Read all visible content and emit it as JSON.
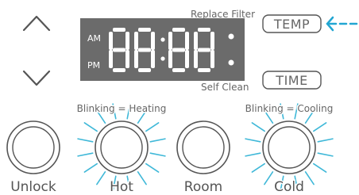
{
  "panel": {
    "replace_filter_label": "Replace Filter",
    "self_clean_label": "Self Clean",
    "temp_button_label": "TEMP",
    "time_button_label": "TIME",
    "am_label": "AM",
    "pm_label": "PM",
    "display_text": "88:88",
    "blinking_heating_label": "Blinking = Heating",
    "blinking_cooling_label": "Blinking = Cooling"
  },
  "buttons": [
    {
      "key": "unlock",
      "label": "Unlock",
      "blinking": false
    },
    {
      "key": "hot",
      "label": "Hot",
      "blinking": true
    },
    {
      "key": "room",
      "label": "Room",
      "blinking": false
    },
    {
      "key": "cold",
      "label": "Cold",
      "blinking": true
    }
  ],
  "colors": {
    "display_bg": "#6b6b6b",
    "display_digits": "#ffffff",
    "outline": "#555555",
    "blink_rays": "#3fb8d8",
    "arrow_indicator": "#22a6d2"
  },
  "icons": {
    "up": "chevron-up-icon",
    "down": "chevron-down-icon",
    "indicator": "dashed-arrow-left-icon"
  }
}
